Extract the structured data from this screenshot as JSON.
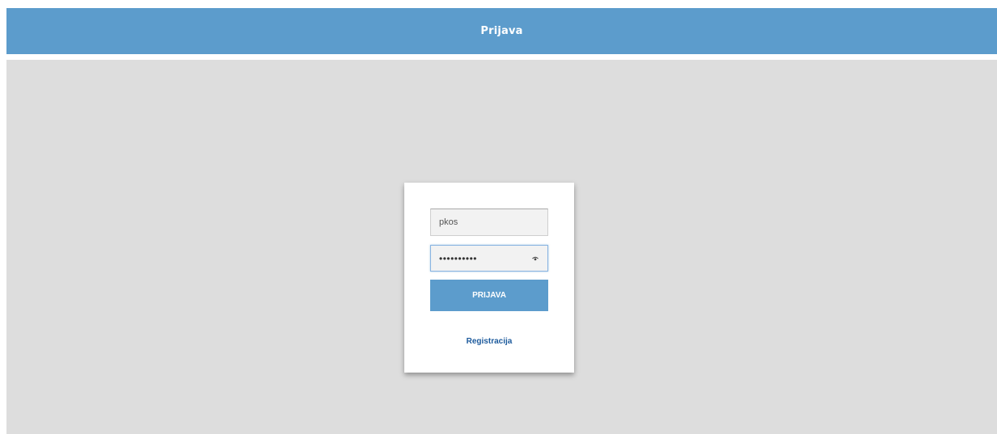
{
  "header": {
    "title": "Prijava"
  },
  "login_form": {
    "username_value": "pkos",
    "password_masked": "••••••••••",
    "password_toggle_icon": "eye-icon",
    "submit_label": "PRIJAVA",
    "register_link": "Registracija"
  },
  "colors": {
    "accent": "#5c9ccc",
    "background": "#dddddd",
    "card": "#ffffff",
    "link": "#1c5a9c"
  }
}
